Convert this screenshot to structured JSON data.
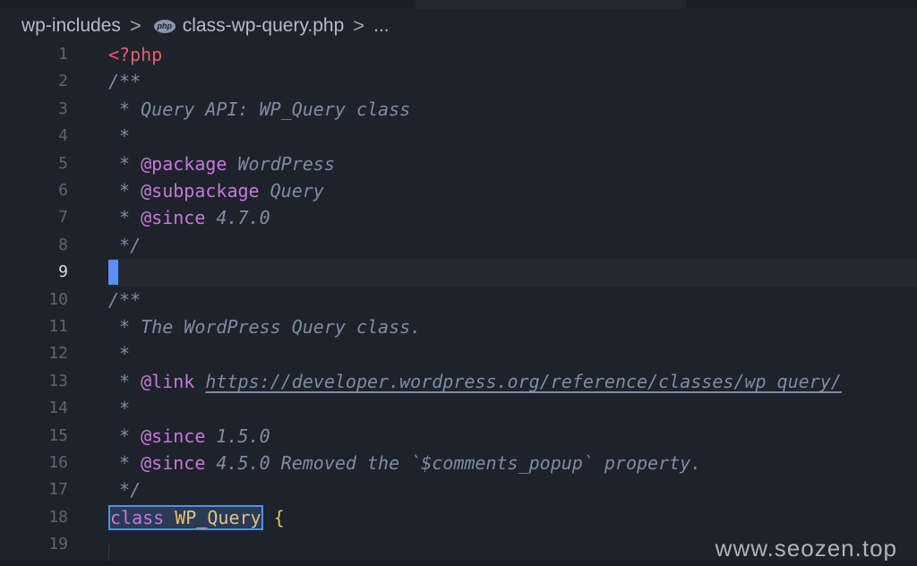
{
  "breadcrumb": {
    "folder": "wp-includes",
    "separator": ">",
    "file_icon_label": "php",
    "file": "class-wp-query.php",
    "more": "..."
  },
  "editor": {
    "active_line": "9",
    "lines": [
      {
        "num": "1",
        "t": [
          "<?php"
        ]
      },
      {
        "num": "2",
        "t": [
          "/**"
        ]
      },
      {
        "num": "3",
        "t": [
          " * Query API: WP_Query class"
        ]
      },
      {
        "num": "4",
        "t": [
          " *"
        ]
      },
      {
        "num": "5",
        "t": [
          " * ",
          "@package",
          " WordPress"
        ]
      },
      {
        "num": "6",
        "t": [
          " * ",
          "@subpackage",
          " Query"
        ]
      },
      {
        "num": "7",
        "t": [
          " * ",
          "@since",
          " 4.7.0"
        ]
      },
      {
        "num": "8",
        "t": [
          " */"
        ]
      },
      {
        "num": "9",
        "t": []
      },
      {
        "num": "10",
        "t": [
          "/**"
        ]
      },
      {
        "num": "11",
        "t": [
          " * The WordPress Query class."
        ]
      },
      {
        "num": "12",
        "t": [
          " *"
        ]
      },
      {
        "num": "13",
        "t": [
          " * ",
          "@link",
          " ",
          "https://developer.wordpress.org/reference/classes/wp_query/"
        ]
      },
      {
        "num": "14",
        "t": [
          " *"
        ]
      },
      {
        "num": "15",
        "t": [
          " * ",
          "@since",
          " 1.5.0"
        ]
      },
      {
        "num": "16",
        "t": [
          " * ",
          "@since",
          " 4.5.0 Removed the `$comments_popup` property."
        ]
      },
      {
        "num": "17",
        "t": [
          " */"
        ]
      },
      {
        "num": "18",
        "t": [
          "class",
          " ",
          "WP_Query",
          " ",
          "{"
        ]
      },
      {
        "num": "19",
        "t": []
      }
    ]
  },
  "colors": {
    "background": "#1e222a",
    "php_tag": "#ef596f",
    "comment": "#7f8ca3",
    "doc_tag": "#c678dd",
    "class_name": "#e5c07b",
    "selection_border": "#4f8ff0",
    "caret": "#5b8ff0"
  },
  "watermark": "www.seozen.top"
}
